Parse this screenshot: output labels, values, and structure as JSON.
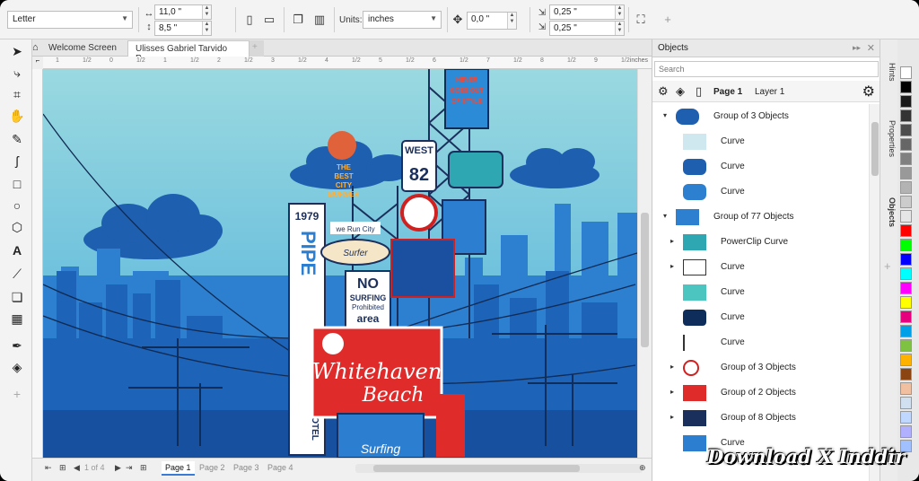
{
  "propbar": {
    "page_size": "Letter",
    "width": "11,0 \"",
    "height": "8,5 \"",
    "units_label": "Units:",
    "units_value": "inches",
    "nudge": "0,0 \"",
    "dup_x": "0,25 \"",
    "dup_y": "0,25 \""
  },
  "tabs": {
    "welcome": "Welcome Screen",
    "document": "Ulisses Gabriel Tarvido P..."
  },
  "ruler": {
    "unit": "inches",
    "marks": [
      "1",
      "1/2",
      "0",
      "1/2",
      "1",
      "1/2",
      "2",
      "1/2",
      "3",
      "1/2",
      "4",
      "1/2",
      "5",
      "1/2",
      "6",
      "1/2",
      "7",
      "1/2",
      "8",
      "1/2",
      "9",
      "1/2"
    ]
  },
  "artwork": {
    "sign_never": "NEVER\nGOES OUT\nOF STYLE",
    "sign_burger": "THE\nBEST\nCITY\nBURGER",
    "sign_west": "WEST",
    "sign_82": "82",
    "sign_1979": "1979",
    "sign_pipe": "PIPE",
    "sign_werun": "we Run City",
    "sign_surfer": "Surfer",
    "sign_no": "NO",
    "sign_surfing": "SURFING",
    "sign_prohibited": "Prohibited",
    "sign_area": "area",
    "sign_whitehaven": "Whitehaven",
    "sign_beach": "Beach",
    "sign_hotel": "HOTEL",
    "sign_surfing_bottom": "Surfing"
  },
  "pagebar": {
    "page_of": "1 of 4",
    "pages": [
      "Page 1",
      "Page 2",
      "Page 3",
      "Page 4"
    ]
  },
  "docker": {
    "title": "Objects",
    "search_placeholder": "Search",
    "page_label": "Page 1",
    "layer_label": "Layer 1",
    "items": [
      {
        "label": "Group of 3 Objects",
        "level": 0,
        "toggle": "▾"
      },
      {
        "label": "Curve",
        "level": 1,
        "toggle": ""
      },
      {
        "label": "Curve",
        "level": 1,
        "toggle": ""
      },
      {
        "label": "Curve",
        "level": 1,
        "toggle": ""
      },
      {
        "label": "Group of 77 Objects",
        "level": 0,
        "toggle": "▾"
      },
      {
        "label": "PowerClip Curve",
        "level": 1,
        "toggle": "▸"
      },
      {
        "label": "Curve",
        "level": 1,
        "toggle": "▸"
      },
      {
        "label": "Curve",
        "level": 1,
        "toggle": ""
      },
      {
        "label": "Curve",
        "level": 1,
        "toggle": ""
      },
      {
        "label": "Curve",
        "level": 1,
        "toggle": ""
      },
      {
        "label": "Group of 3 Objects",
        "level": 1,
        "toggle": "▸"
      },
      {
        "label": "Group of 2 Objects",
        "level": 1,
        "toggle": "▸"
      },
      {
        "label": "Group of 8 Objects",
        "level": 1,
        "toggle": "▸"
      },
      {
        "label": "Curve",
        "level": 1,
        "toggle": ""
      }
    ]
  },
  "sidetabs": [
    "Hints",
    "Properties",
    "Objects"
  ],
  "palette": [
    "#ffffff",
    "#000000",
    "#1a1a1a",
    "#333333",
    "#4d4d4d",
    "#666666",
    "#808080",
    "#999999",
    "#b3b3b3",
    "#cccccc",
    "#e6e6e6",
    "#ff0000",
    "#00ff00",
    "#0000ff",
    "#00ffff",
    "#ff00ff",
    "#ffff00",
    "#e6007e",
    "#00a0e9",
    "#7fc241",
    "#ffb300",
    "#8b4513",
    "#f0c0a0",
    "#d0e0f0",
    "#c0d8ff",
    "#b0b0ff",
    "#a0c0ff"
  ],
  "watermark": "Download X Inddir"
}
